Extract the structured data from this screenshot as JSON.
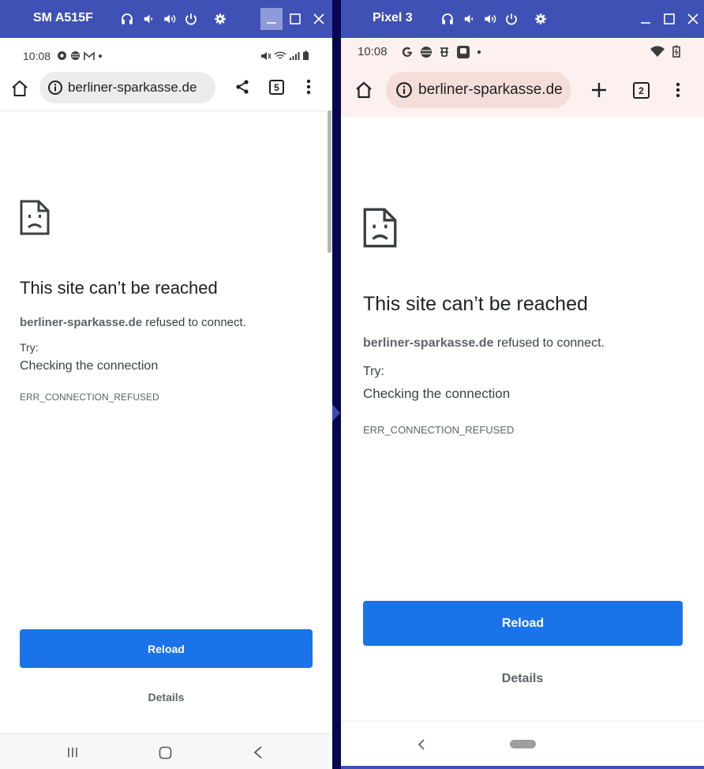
{
  "colors": {
    "titlebar": "#3f51b5",
    "reload_button": "#1a73e8",
    "backdrop": "#0a0a5a"
  },
  "left_device": {
    "window_title": "SM A515F",
    "title_icons": [
      "headphones-icon",
      "volume-down-icon",
      "volume-up-icon",
      "power-icon",
      "settings-icon"
    ],
    "status_time": "10:08",
    "url": "berliner-sparkasse.de",
    "tab_count": "5",
    "error_title": "This site can’t be reached",
    "error_host": "berliner-sparkasse.de",
    "error_suffix": " refused to connect.",
    "try_label": "Try:",
    "suggestion": "Checking the connection",
    "error_code": "ERR_CONNECTION_REFUSED",
    "reload_label": "Reload",
    "details_label": "Details"
  },
  "right_device": {
    "window_title": "Pixel 3",
    "title_icons": [
      "headphones-icon",
      "volume-down-icon",
      "volume-up-icon",
      "power-icon",
      "settings-icon"
    ],
    "status_time": "10:08",
    "url": "berliner-sparkasse.de",
    "tab_count": "2",
    "error_title": "This site can’t be reached",
    "error_host": "berliner-sparkasse.de",
    "error_suffix": " refused to connect.",
    "try_label": "Try:",
    "suggestion": "Checking the connection",
    "error_code": "ERR_CONNECTION_REFUSED",
    "reload_label": "Reload",
    "details_label": "Details"
  }
}
